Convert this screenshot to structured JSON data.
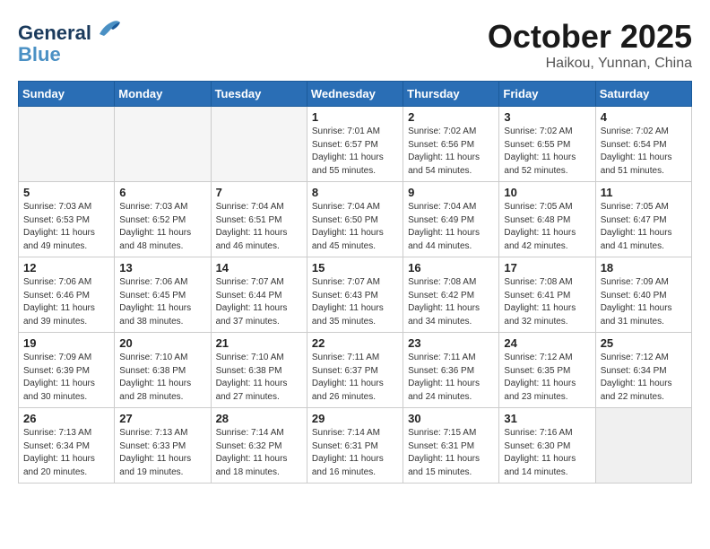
{
  "header": {
    "logo_line1": "General",
    "logo_line2": "Blue",
    "month": "October 2025",
    "location": "Haikou, Yunnan, China"
  },
  "days_of_week": [
    "Sunday",
    "Monday",
    "Tuesday",
    "Wednesday",
    "Thursday",
    "Friday",
    "Saturday"
  ],
  "weeks": [
    [
      {
        "num": "",
        "info": ""
      },
      {
        "num": "",
        "info": ""
      },
      {
        "num": "",
        "info": ""
      },
      {
        "num": "1",
        "info": "Sunrise: 7:01 AM\nSunset: 6:57 PM\nDaylight: 11 hours and 55 minutes."
      },
      {
        "num": "2",
        "info": "Sunrise: 7:02 AM\nSunset: 6:56 PM\nDaylight: 11 hours and 54 minutes."
      },
      {
        "num": "3",
        "info": "Sunrise: 7:02 AM\nSunset: 6:55 PM\nDaylight: 11 hours and 52 minutes."
      },
      {
        "num": "4",
        "info": "Sunrise: 7:02 AM\nSunset: 6:54 PM\nDaylight: 11 hours and 51 minutes."
      }
    ],
    [
      {
        "num": "5",
        "info": "Sunrise: 7:03 AM\nSunset: 6:53 PM\nDaylight: 11 hours and 49 minutes."
      },
      {
        "num": "6",
        "info": "Sunrise: 7:03 AM\nSunset: 6:52 PM\nDaylight: 11 hours and 48 minutes."
      },
      {
        "num": "7",
        "info": "Sunrise: 7:04 AM\nSunset: 6:51 PM\nDaylight: 11 hours and 46 minutes."
      },
      {
        "num": "8",
        "info": "Sunrise: 7:04 AM\nSunset: 6:50 PM\nDaylight: 11 hours and 45 minutes."
      },
      {
        "num": "9",
        "info": "Sunrise: 7:04 AM\nSunset: 6:49 PM\nDaylight: 11 hours and 44 minutes."
      },
      {
        "num": "10",
        "info": "Sunrise: 7:05 AM\nSunset: 6:48 PM\nDaylight: 11 hours and 42 minutes."
      },
      {
        "num": "11",
        "info": "Sunrise: 7:05 AM\nSunset: 6:47 PM\nDaylight: 11 hours and 41 minutes."
      }
    ],
    [
      {
        "num": "12",
        "info": "Sunrise: 7:06 AM\nSunset: 6:46 PM\nDaylight: 11 hours and 39 minutes."
      },
      {
        "num": "13",
        "info": "Sunrise: 7:06 AM\nSunset: 6:45 PM\nDaylight: 11 hours and 38 minutes."
      },
      {
        "num": "14",
        "info": "Sunrise: 7:07 AM\nSunset: 6:44 PM\nDaylight: 11 hours and 37 minutes."
      },
      {
        "num": "15",
        "info": "Sunrise: 7:07 AM\nSunset: 6:43 PM\nDaylight: 11 hours and 35 minutes."
      },
      {
        "num": "16",
        "info": "Sunrise: 7:08 AM\nSunset: 6:42 PM\nDaylight: 11 hours and 34 minutes."
      },
      {
        "num": "17",
        "info": "Sunrise: 7:08 AM\nSunset: 6:41 PM\nDaylight: 11 hours and 32 minutes."
      },
      {
        "num": "18",
        "info": "Sunrise: 7:09 AM\nSunset: 6:40 PM\nDaylight: 11 hours and 31 minutes."
      }
    ],
    [
      {
        "num": "19",
        "info": "Sunrise: 7:09 AM\nSunset: 6:39 PM\nDaylight: 11 hours and 30 minutes."
      },
      {
        "num": "20",
        "info": "Sunrise: 7:10 AM\nSunset: 6:38 PM\nDaylight: 11 hours and 28 minutes."
      },
      {
        "num": "21",
        "info": "Sunrise: 7:10 AM\nSunset: 6:38 PM\nDaylight: 11 hours and 27 minutes."
      },
      {
        "num": "22",
        "info": "Sunrise: 7:11 AM\nSunset: 6:37 PM\nDaylight: 11 hours and 26 minutes."
      },
      {
        "num": "23",
        "info": "Sunrise: 7:11 AM\nSunset: 6:36 PM\nDaylight: 11 hours and 24 minutes."
      },
      {
        "num": "24",
        "info": "Sunrise: 7:12 AM\nSunset: 6:35 PM\nDaylight: 11 hours and 23 minutes."
      },
      {
        "num": "25",
        "info": "Sunrise: 7:12 AM\nSunset: 6:34 PM\nDaylight: 11 hours and 22 minutes."
      }
    ],
    [
      {
        "num": "26",
        "info": "Sunrise: 7:13 AM\nSunset: 6:34 PM\nDaylight: 11 hours and 20 minutes."
      },
      {
        "num": "27",
        "info": "Sunrise: 7:13 AM\nSunset: 6:33 PM\nDaylight: 11 hours and 19 minutes."
      },
      {
        "num": "28",
        "info": "Sunrise: 7:14 AM\nSunset: 6:32 PM\nDaylight: 11 hours and 18 minutes."
      },
      {
        "num": "29",
        "info": "Sunrise: 7:14 AM\nSunset: 6:31 PM\nDaylight: 11 hours and 16 minutes."
      },
      {
        "num": "30",
        "info": "Sunrise: 7:15 AM\nSunset: 6:31 PM\nDaylight: 11 hours and 15 minutes."
      },
      {
        "num": "31",
        "info": "Sunrise: 7:16 AM\nSunset: 6:30 PM\nDaylight: 11 hours and 14 minutes."
      },
      {
        "num": "",
        "info": ""
      }
    ]
  ]
}
